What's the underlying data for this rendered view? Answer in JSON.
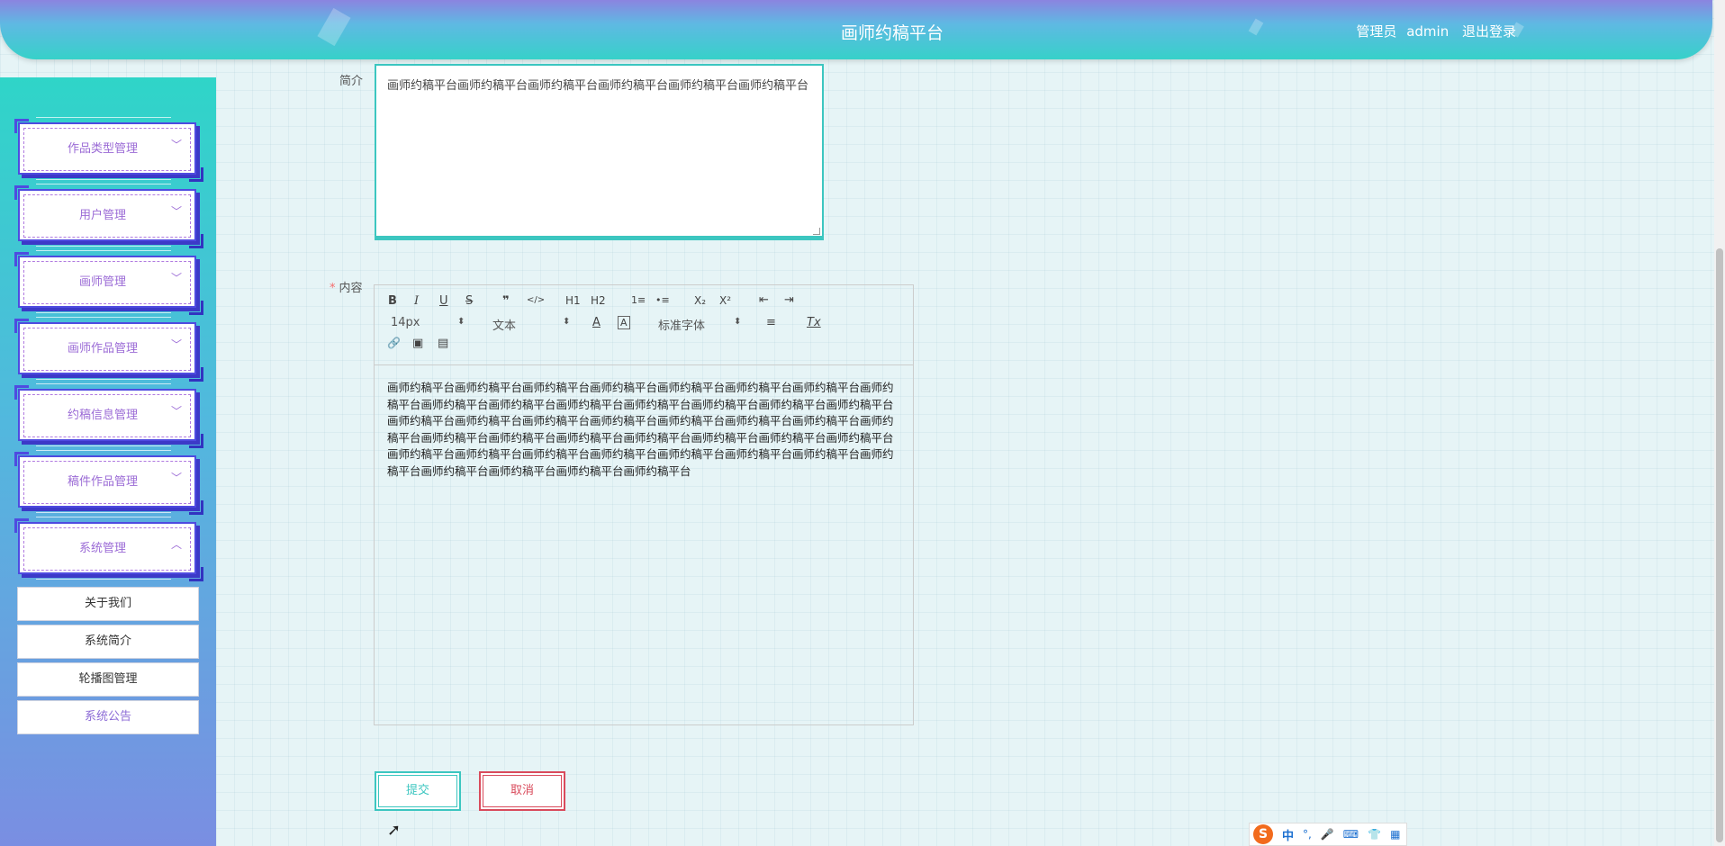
{
  "header": {
    "title": "画师约稿平台",
    "role": "管理员",
    "username": "admin",
    "logout_label": "退出登录"
  },
  "sidebar": {
    "items": [
      {
        "label": "作品类型管理",
        "chevron": "chevron-down-icon"
      },
      {
        "label": "用户管理",
        "chevron": "chevron-down-icon"
      },
      {
        "label": "画师管理",
        "chevron": "chevron-down-icon"
      },
      {
        "label": "画师作品管理",
        "chevron": "chevron-down-icon"
      },
      {
        "label": "约稿信息管理",
        "chevron": "chevron-down-icon"
      },
      {
        "label": "稿件作品管理",
        "chevron": "chevron-down-icon"
      },
      {
        "label": "系统管理",
        "chevron": "chevron-up-icon"
      }
    ],
    "submenu": [
      {
        "label": "关于我们"
      },
      {
        "label": "系统简介"
      },
      {
        "label": "轮播图管理"
      },
      {
        "label": "系统公告"
      }
    ]
  },
  "form": {
    "intro_label": "简介",
    "intro_value": "画师约稿平台画师约稿平台画师约稿平台画师约稿平台画师约稿平台画师约稿平台",
    "content_label": "内容",
    "required_mark": "*",
    "content_value": "画师约稿平台画师约稿平台画师约稿平台画师约稿平台画师约稿平台画师约稿平台画师约稿平台画师约稿平台画师约稿平台画师约稿平台画师约稿平台画师约稿平台画师约稿平台画师约稿平台画师约稿平台画师约稿平台画师约稿平台画师约稿平台画师约稿平台画师约稿平台画师约稿平台画师约稿平台画师约稿平台画师约稿平台画师约稿平台画师约稿平台画师约稿平台画师约稿平台画师约稿平台画师约稿平台画师约稿平台画师约稿平台画师约稿平台画师约稿平台画师约稿平台画师约稿平台画师约稿平台画师约稿平台画师约稿平台画师约稿平台画师约稿平台画师约稿平台",
    "submit_label": "提交",
    "cancel_label": "取消"
  },
  "editor_toolbar": {
    "bold": "B",
    "italic": "I",
    "underline": "U",
    "strike": "S",
    "quote": "❞",
    "code": "</>",
    "h1": "H1",
    "h2": "H2",
    "ordered_list": "1≡",
    "bullet_list": "•≡",
    "subscript": "X₂",
    "superscript": "X²",
    "indent_left": "⇤",
    "indent_right": "⇥",
    "size_select": "14px",
    "type_select": "文本",
    "color": "A",
    "background": "A",
    "font_select": "标准字体",
    "align": "≡",
    "clean": "Tx",
    "link": "🔗",
    "image": "▣",
    "video": "▤"
  },
  "ime": {
    "logo": "S",
    "lang": "中",
    "punct": "°,",
    "mic": "🎤",
    "keyboard": "⌨",
    "skin": "👕",
    "grid": "▦"
  }
}
